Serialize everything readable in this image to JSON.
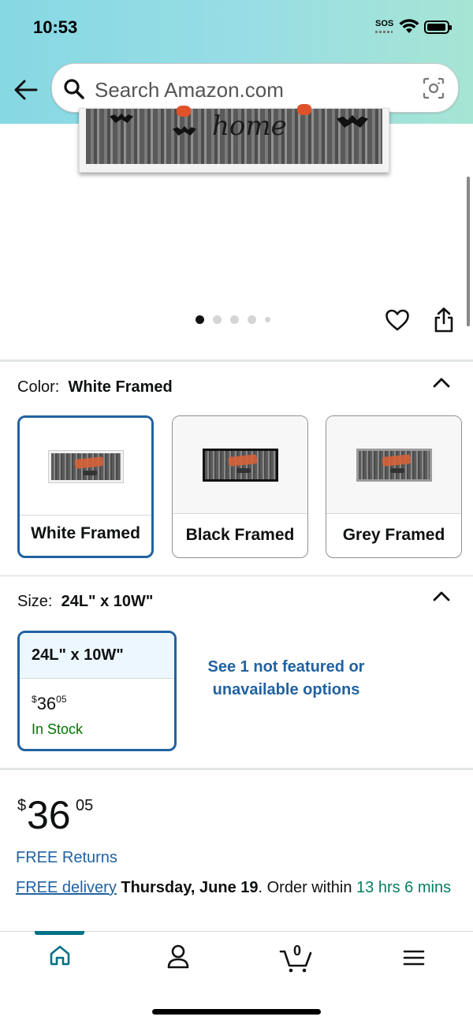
{
  "status_bar": {
    "time": "10:53",
    "sos": "SOS"
  },
  "header": {
    "search_placeholder": "Search Amazon.com"
  },
  "product_image": {
    "text": "home",
    "carousel_dots": 5,
    "active_dot": 0
  },
  "color": {
    "label": "Color:",
    "selected": "White Framed",
    "options": [
      {
        "label": "White Framed",
        "selected": true
      },
      {
        "label": "Black Framed",
        "selected": false
      },
      {
        "label": "Grey Framed",
        "selected": false
      }
    ]
  },
  "size": {
    "label": "Size:",
    "selected": "24L\" x 10W\"",
    "option": {
      "label": "24L\" x 10W\"",
      "price_symbol": "$",
      "price_whole": "36",
      "price_fraction": "05",
      "stock": "In Stock"
    },
    "see_more_link": "See 1 not featured or unavailable options"
  },
  "price": {
    "symbol": "$",
    "whole": "36",
    "fraction": "05"
  },
  "free_returns": "FREE Returns",
  "delivery": {
    "link": "FREE delivery",
    "date": "Thursday, June 19",
    "order_within_text": ". Order within",
    "countdown": "13 hrs 6 mins"
  },
  "bottom_nav": {
    "cart_count": "0",
    "active": "home"
  },
  "colors": {
    "link_blue": "#2162a1",
    "stock_green": "#007600",
    "selected_border": "#2162a1",
    "nav_active": "#007185"
  }
}
